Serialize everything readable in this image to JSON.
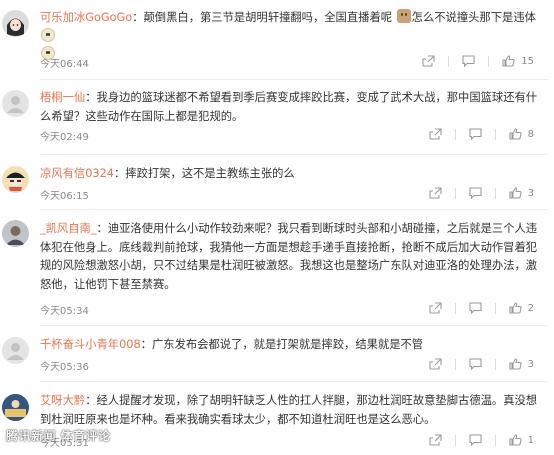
{
  "comments": [
    {
      "username": "可乐加冰GoGoGo",
      "separator": "：",
      "text_parts": [
        "颠倒黑白，第三节是胡明轩撞翻吗，全国直播着呢",
        "怎么不说撞头那下是违体"
      ],
      "emojis": [
        "cat-emoji",
        "sheep-emoji",
        "sheep-emoji"
      ],
      "time": "今天06:44",
      "likes": "15"
    },
    {
      "username": "梧桐一仙",
      "separator": "：",
      "text": "我身边的篮球迷都不希望看到季后赛变成摔跤比赛，变成了武术大战，那中国篮球还有什么希望？这些动作在国际上都是犯规的。",
      "time": "今天02:49",
      "likes": "8"
    },
    {
      "username": "凉风有信0324",
      "separator": "：",
      "text": "摔跤打架，这不是主教练主张的么",
      "time": "今天06:15",
      "likes": "3"
    },
    {
      "username": "_凯风自南_",
      "separator": "：",
      "text": "迪亚洛使用什么小动作较劲来呢？我只看到断球时头部和小胡碰撞，之后就是三个人违体犯在他身上。底线裁判前抢球，我猜他一方面是想趁手递手直接抢断，抢断不成后加大动作冒着犯规的风险想激怒小胡，只不过结果是杜润旺被激怒。我想这也是整场广东队对迪亚洛的处理办法，激怒他，让他罚下甚至禁赛。",
      "time": "今天05:34",
      "likes": "2"
    },
    {
      "username": "千杯奋斗小青年008",
      "separator": "：",
      "text": "广东发布会都说了，就是打架就是摔跤，结果就是不管",
      "time": "今天05:36",
      "likes": "3"
    },
    {
      "username": "艾呀大黔",
      "separator": "：",
      "text": "经人提醒才发现，除了胡明轩缺乏人性的扛人拌腿，那边杜润旺故意垫脚古德温。真没想到杜润旺原来也是坏种。看来我确实看球太少，都不知道杜润旺也是这么恶心。",
      "time": "今天05:31",
      "likes": "1"
    }
  ],
  "watermark": "腾讯新闻 体育评论",
  "colors": {
    "username": "#eb7350",
    "text": "#333333",
    "meta": "#8a8a8a"
  }
}
